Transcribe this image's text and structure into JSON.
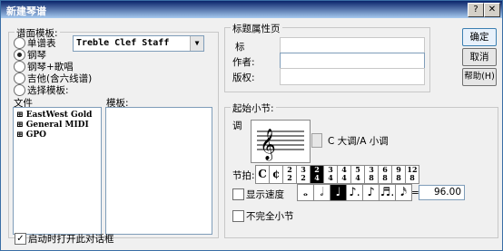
{
  "window": {
    "title": "新建琴谱",
    "help_btn": "?",
    "close_btn": "✕"
  },
  "template": {
    "legend": "谱面模板:",
    "options": [
      {
        "label": "单谱表",
        "selected": false
      },
      {
        "label": "钢琴",
        "selected": true
      },
      {
        "label": "钢琴+歌唱",
        "selected": false
      },
      {
        "label": "吉他(含六线谱)",
        "selected": false
      },
      {
        "label": "选择模板:",
        "selected": false
      }
    ],
    "staff_select": "Treble Clef Staff",
    "file_label": "文件",
    "template_label": "模板:",
    "file_items": [
      "EastWest Gold",
      "General MIDI",
      "GPO"
    ]
  },
  "title_props": {
    "legend": "标题属性页",
    "title_label": "标",
    "composer_label": "作者:",
    "copyright_label": "版权:",
    "title_value": "",
    "composer_value": "",
    "copyright_value": ""
  },
  "start_measure": {
    "legend": "起始小节:",
    "key_label": "调",
    "key_value": "C 大调/A 小调",
    "time_label": "节拍:",
    "time_sigs": [
      "C",
      "¢",
      "2/2",
      "3/2",
      "2/4",
      "3/4",
      "4/4",
      "5/4",
      "3/8",
      "6/8",
      "9/8",
      "12/8"
    ],
    "time_selected_index": 4,
    "tempo_label": "显示速度",
    "tempo_checked": false,
    "note_values": [
      "𝅝",
      "𝅗𝅥",
      "♩",
      "♪.",
      "♪",
      "♬.",
      "𝅘𝅥𝅯"
    ],
    "note_selected_index": 2,
    "equals": "=",
    "tempo_value": "96.00",
    "pickup_label": "不完全小节",
    "pickup_checked": false
  },
  "buttons": {
    "ok": "确定",
    "cancel": "取消",
    "help": "帮助(H)"
  },
  "footer": {
    "show_on_startup_label": "启动时打开此对话框",
    "show_on_startup_checked": true
  }
}
